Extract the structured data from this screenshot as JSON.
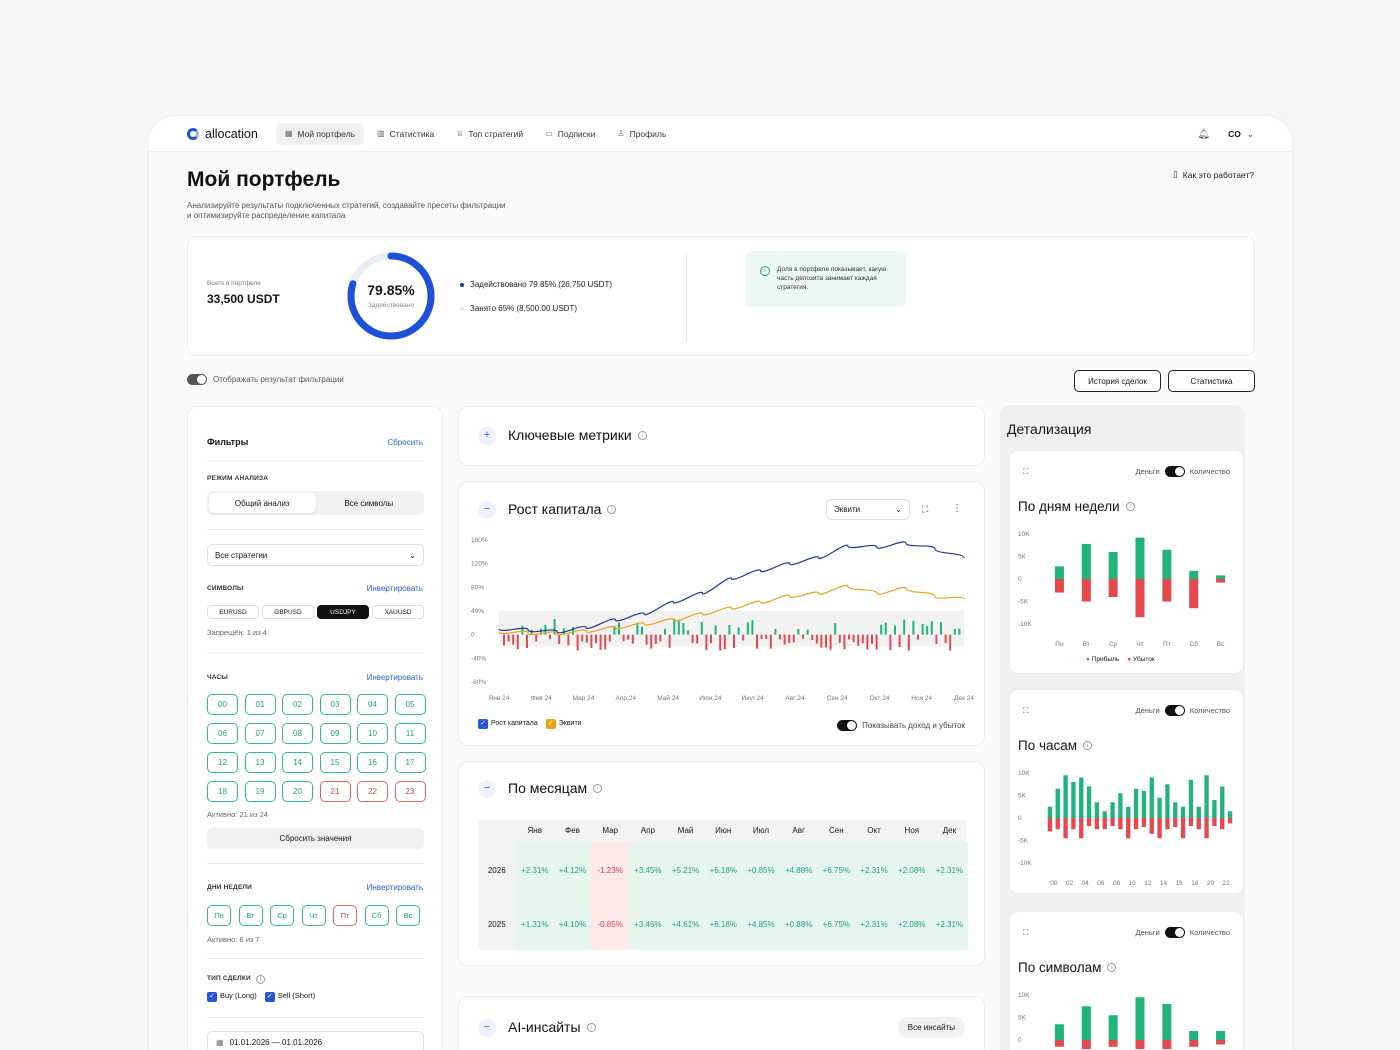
{
  "app": {
    "logo": "allocation"
  },
  "nav": [
    {
      "label": "Мой портфель",
      "icon": "grid-icon",
      "active": true
    },
    {
      "label": "Статистика",
      "icon": "bar-chart-icon"
    },
    {
      "label": "Топ стратегий",
      "icon": "trophy-icon"
    },
    {
      "label": "Подписки",
      "icon": "folder-icon"
    },
    {
      "label": "Профиль",
      "icon": "user-icon"
    }
  ],
  "user": {
    "initials": "CO"
  },
  "page": {
    "title": "Мой портфель",
    "description": "Анализируйте результаты подключенных стратегий, создавайте пресеты фильтрации и оптимизируйте распределение капитала",
    "how_it_works": "Как это работает?"
  },
  "summary": {
    "total_label": "Всего в портфеле",
    "total_value": "33,500 USDT",
    "donut_value": "79.85%",
    "donut_percent": 79.85,
    "donut_sub": "Задействовано",
    "legend_used": "Задействовано 79.85% (26,750 USDT)",
    "legend_taken": "Занято 65% (8,500.00 USDT)",
    "info": "Доля в портфеле показывает, какую часть депозита занимает каждая стратегия."
  },
  "filter_toggle_label": "Отображать результат фильтрации",
  "buttons": {
    "history": "История сделок",
    "stats": "Статистика"
  },
  "filters": {
    "title": "Фильтры",
    "reset": "Сбросить",
    "mode_label": "РЕЖИМ АНАЛИЗА",
    "modes": [
      "Общий анализ",
      "Все символы"
    ],
    "strategy_select": "Все стратегии",
    "symbols_label": "СИМВОЛЫ",
    "invert": "Инвертировать",
    "symbols": [
      "EURUSD",
      "GBPUSD",
      "USDJPY",
      "XAUUSD"
    ],
    "symbols_forbidden": "Запрещён: 1 из 4",
    "hours_label": "ЧАСЫ",
    "hours": [
      "00",
      "01",
      "02",
      "03",
      "04",
      "05",
      "06",
      "07",
      "08",
      "09",
      "10",
      "11",
      "12",
      "13",
      "14",
      "15",
      "16",
      "17",
      "18",
      "19",
      "20",
      "21",
      "22",
      "23"
    ],
    "hours_off": [
      "21",
      "22",
      "23"
    ],
    "hours_active": "Активно: 21 из 24",
    "reset_values": "Сбросить значения",
    "days_label": "ДНИ НЕДЕЛИ",
    "days": [
      "Пн",
      "Вт",
      "Ср",
      "Чт",
      "Пт",
      "Сб",
      "Вс"
    ],
    "days_off": [
      "Пт"
    ],
    "days_active": "Активно: 6 из 7",
    "trade_type_label": "ТИП СДЕЛКИ",
    "trade_types": [
      "Buy (Long)",
      "Sell (Short)"
    ],
    "date_range": "01.01.2026 — 01.01.2026"
  },
  "key_metrics": {
    "title": "Ключевые метрики"
  },
  "growth": {
    "title": "Рост капитала",
    "select": "Эквити",
    "legend": [
      "Рост капитала",
      "Эквити"
    ],
    "show_pl": "Показывать доход и убыток"
  },
  "monthly": {
    "title": "По месяцам",
    "months": [
      "Янв",
      "Фев",
      "Мар",
      "Апр",
      "Май",
      "Июн",
      "Июл",
      "Авг",
      "Сен",
      "Окт",
      "Ноя",
      "Дек"
    ],
    "rows": [
      {
        "year": "2026",
        "values": [
          "+2.31%",
          "+4.12%",
          "-1.23%",
          "+3.45%",
          "+5.21%",
          "+6.18%",
          "+0.85%",
          "+4.88%",
          "+6.75%",
          "+2.31%",
          "+2.08%",
          "+2.31%"
        ]
      },
      {
        "year": "2025",
        "values": [
          "+1.31%",
          "+4.10%",
          "-0.85%",
          "+3.45%",
          "+4.61%",
          "+6.18%",
          "+4.85%",
          "+0.88%",
          "+6.75%",
          "+2.31%",
          "+2.08%",
          "+2.31%"
        ]
      }
    ]
  },
  "ai": {
    "title": "AI-инсайты",
    "all": "Все инсайты"
  },
  "details": {
    "title": "Детализация",
    "money": "Деньги",
    "count": "Количество",
    "by_weekday": "По дням недели",
    "by_hour": "По часам",
    "by_symbol": "По символам",
    "profit": "Прибыль",
    "loss": "Убыток"
  },
  "colors": {
    "accent": "#1e4fd8",
    "profit": "#1fb47a",
    "loss": "#e5484d",
    "equity": "#e8a317"
  },
  "chart_data": [
    {
      "type": "line",
      "title": "Рост капитала",
      "x": [
        "Янв 24",
        "Фев 24",
        "Мар 24",
        "Апр 24",
        "Май 24",
        "Июн 24",
        "Июл 24",
        "Авг 24",
        "Сен 24",
        "Окт 24",
        "Ноя 24",
        "Дек 24"
      ],
      "y_ticks": [
        "160%",
        "120%",
        "80%",
        "40%",
        "0",
        "-40%",
        "-80%"
      ],
      "ylim": [
        -80,
        160
      ],
      "series": [
        {
          "name": "Рост капитала",
          "color": "#1e3a8a",
          "values": [
            10,
            8,
            5,
            12,
            25,
            35,
            55,
            70,
            95,
            108,
            120,
            130,
            150,
            148,
            155,
            145,
            130
          ]
        },
        {
          "name": "Эквити",
          "color": "#e8a317",
          "values": [
            5,
            3,
            2,
            6,
            12,
            18,
            25,
            35,
            45,
            55,
            65,
            70,
            82,
            70,
            78,
            65,
            60
          ]
        }
      ]
    },
    {
      "type": "bar",
      "title": "По дням недели",
      "categories": [
        "Пн",
        "Вт",
        "Ср",
        "Чт",
        "Пт",
        "Сб",
        "Вс"
      ],
      "y_ticks": [
        "10K",
        "5K",
        "0",
        "-5K",
        "-10K"
      ],
      "ylim": [
        -10000,
        10000
      ],
      "series": [
        {
          "name": "Прибыль",
          "values": [
            2800,
            7800,
            6000,
            9200,
            6500,
            1800,
            800
          ]
        },
        {
          "name": "Убыток",
          "values": [
            -3000,
            -5000,
            -4000,
            -8500,
            -5000,
            -6500,
            -800
          ]
        }
      ]
    },
    {
      "type": "bar",
      "title": "По часам",
      "categories": [
        "00",
        "02",
        "04",
        "06",
        "08",
        "10",
        "12",
        "14",
        "16",
        "18",
        "20",
        "22"
      ],
      "y_ticks": [
        "10K",
        "5K",
        "0",
        "-5K",
        "-10K"
      ],
      "ylim": [
        -10000,
        10000
      ],
      "series": [
        {
          "name": "Прибыль",
          "values": [
            2500,
            6500,
            9500,
            8000,
            9000,
            7000,
            3500,
            1500,
            3500,
            5500,
            2500,
            6500,
            6000,
            9000,
            4500,
            7500,
            3500,
            2500,
            8500,
            2500,
            9500,
            4000,
            7000,
            1500
          ]
        },
        {
          "name": "Убыток",
          "values": [
            -3000,
            -2500,
            -4500,
            -2500,
            -4500,
            -1800,
            -2500,
            -2500,
            -1800,
            -2500,
            -4500,
            -2500,
            -2000,
            -3500,
            -4500,
            -2500,
            -2000,
            -4500,
            -1800,
            -2500,
            -4500,
            -1800,
            -2500,
            -1200
          ]
        }
      ]
    },
    {
      "type": "bar",
      "title": "По символам",
      "y_ticks": [
        "10K",
        "5K",
        "0"
      ],
      "ylim": [
        -10000,
        10000
      ],
      "series": [
        {
          "name": "Прибыль",
          "values": [
            3500,
            7500,
            5500,
            9500,
            8000,
            2000,
            2000
          ]
        },
        {
          "name": "Убыток",
          "values": [
            -1500,
            -2000,
            -1500,
            -2000,
            -2000,
            -1500,
            -1000
          ]
        }
      ]
    }
  ]
}
